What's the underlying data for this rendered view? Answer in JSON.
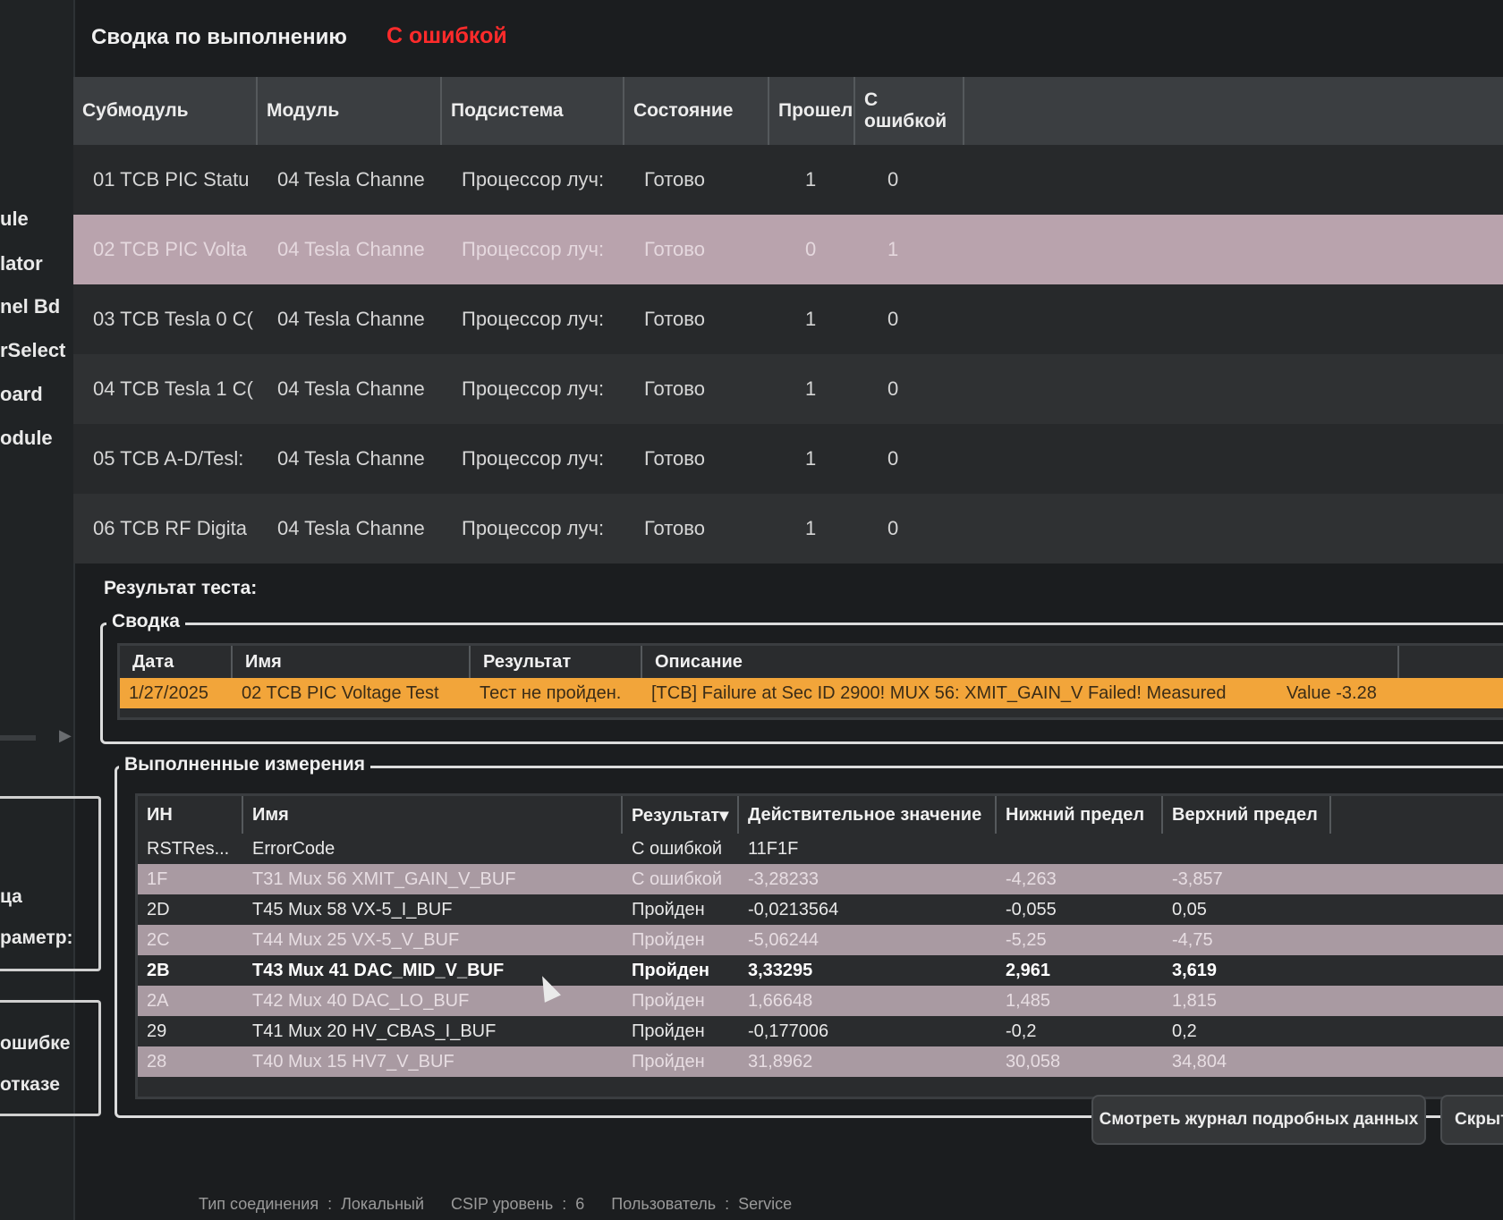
{
  "sidebar": {
    "items": [
      "ule",
      "lator",
      "nel Bd",
      "rSelect",
      "oard",
      "odule"
    ],
    "box1_items": [
      "ца",
      "раметр:"
    ],
    "box2_items": [
      "ошибке",
      "отказе"
    ],
    "scroll_arrow": "▶"
  },
  "header": {
    "title": "Сводка по выполнению",
    "status": "С ошибкой",
    "status_color": "#ff2b2b"
  },
  "grid": {
    "columns": [
      "Субмодуль",
      "Модуль",
      "Подсистема",
      "Состояние",
      "Прошел",
      "С ошибкой"
    ],
    "rows": [
      {
        "sub": "01 TCB PIC Statu",
        "mod": "04 Tesla Channe",
        "subsys": "Процессор луч:",
        "state": "Готово",
        "passed": "1",
        "failed": "0"
      },
      {
        "sub": "02 TCB PIC Volta",
        "mod": "04 Tesla Channe",
        "subsys": "Процессор луч:",
        "state": "Готово",
        "passed": "0",
        "failed": "1"
      },
      {
        "sub": "03 TCB Tesla 0 C(",
        "mod": "04 Tesla Channe",
        "subsys": "Процессор луч:",
        "state": "Готово",
        "passed": "1",
        "failed": "0"
      },
      {
        "sub": "04 TCB Tesla 1 C(",
        "mod": "04 Tesla Channe",
        "subsys": "Процессор луч:",
        "state": "Готово",
        "passed": "1",
        "failed": "0"
      },
      {
        "sub": "05 TCB A-D/Tesl:",
        "mod": "04 Tesla Channe",
        "subsys": "Процессор луч:",
        "state": "Готово",
        "passed": "1",
        "failed": "0"
      },
      {
        "sub": "06 TCB RF Digita",
        "mod": "04 Tesla Channe",
        "subsys": "Процессор луч:",
        "state": "Готово",
        "passed": "1",
        "failed": "0"
      }
    ]
  },
  "result_label": "Результат теста:",
  "summary": {
    "group_title": "Сводка",
    "columns": [
      "Дата",
      "Имя",
      "Результат",
      "Описание"
    ],
    "row": {
      "date": "1/27/2025",
      "name": "02 TCB PIC Voltage Test",
      "result": "Тест не пройден.",
      "description": "[TCB] Failure at Sec ID 2900! MUX 56: XMIT_GAIN_V Failed! Measured",
      "value": "Value -3.28"
    },
    "highlight_color": "#f2a53a"
  },
  "measurements": {
    "group_title": "Выполненные измерения",
    "columns": [
      "ИН",
      "Имя",
      "Результат▾",
      "Действительное значение",
      "Нижний предел",
      "Верхний предел"
    ],
    "rows": [
      {
        "id": "RSTRes...",
        "name": "ErrorCode",
        "result": "С ошибкой",
        "actual": "11F1F",
        "low": "",
        "high": ""
      },
      {
        "id": "1F",
        "name": "T31 Mux 56 XMIT_GAIN_V_BUF",
        "result": "С ошибкой",
        "actual": "-3,28233",
        "low": "-4,263",
        "high": "-3,857"
      },
      {
        "id": "2D",
        "name": "T45 Mux 58 VX-5_I_BUF",
        "result": "Пройден",
        "actual": "-0,0213564",
        "low": "-0,055",
        "high": "0,05"
      },
      {
        "id": "2C",
        "name": "T44 Mux 25 VX-5_V_BUF",
        "result": "Пройден",
        "actual": "-5,06244",
        "low": "-5,25",
        "high": "-4,75"
      },
      {
        "id": "2B",
        "name": "T43 Mux 41 DAC_MID_V_BUF",
        "result": "Пройден",
        "actual": "3,33295",
        "low": "2,961",
        "high": "3,619"
      },
      {
        "id": "2A",
        "name": "T42 Mux 40 DAC_LO_BUF",
        "result": "Пройден",
        "actual": "1,66648",
        "low": "1,485",
        "high": "1,815"
      },
      {
        "id": "29",
        "name": "T41 Mux 20 HV_CBAS_I_BUF",
        "result": "Пройден",
        "actual": "-0,177006",
        "low": "-0,2",
        "high": "0,2"
      },
      {
        "id": "28",
        "name": "T40 Mux 15 HV7_V_BUF",
        "result": "Пройден",
        "actual": "31,8962",
        "low": "30,058",
        "high": "34,804"
      }
    ]
  },
  "buttons": {
    "view_log": "Смотреть журнал подробных данных",
    "hide": "Скрыт"
  },
  "statusbar": {
    "conn_label": "Тип соединения",
    "conn_value": "Локальный",
    "csip_label": "CSIP уровень",
    "csip_value": "6",
    "user_label": "Пользователь",
    "user_value": "Service",
    "sep": ":"
  }
}
